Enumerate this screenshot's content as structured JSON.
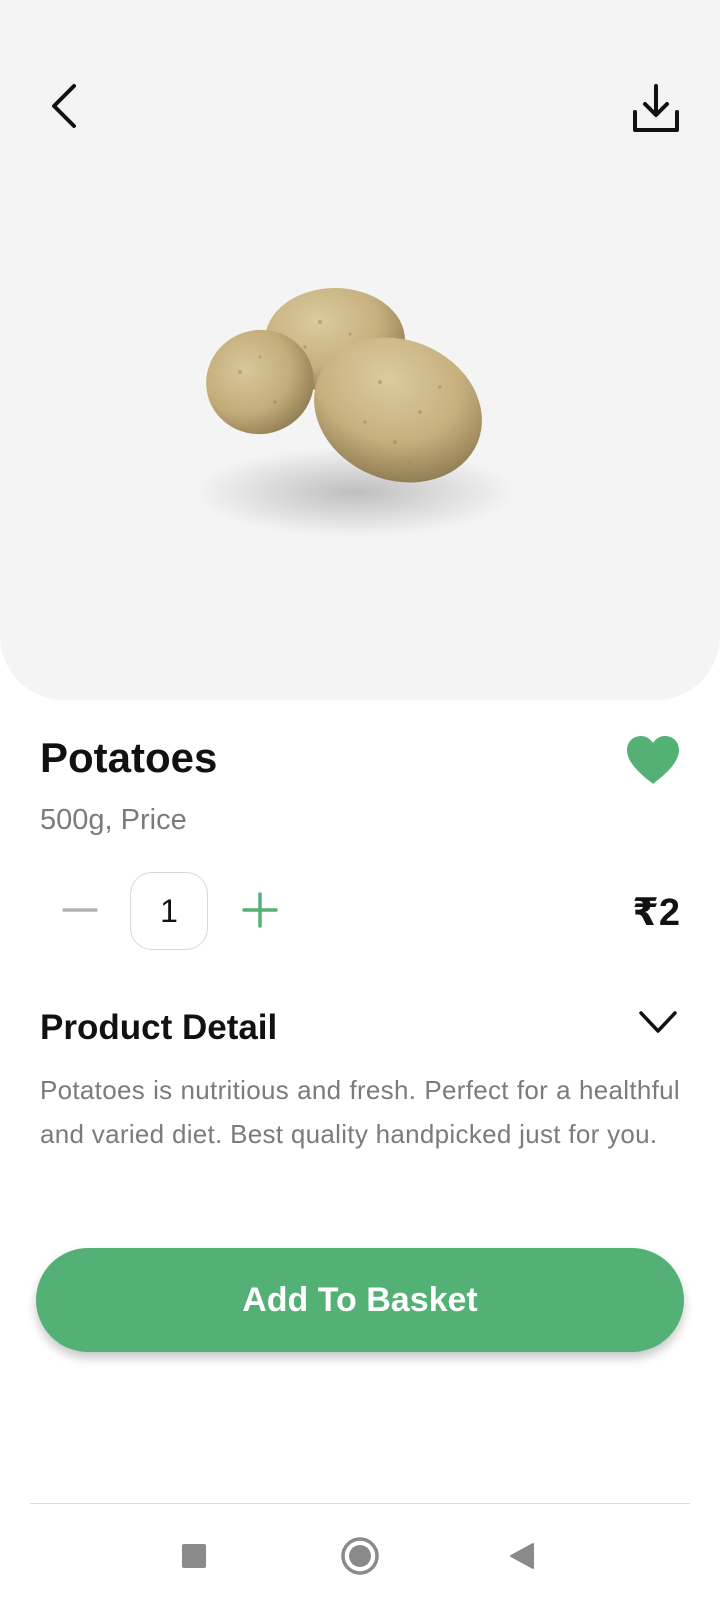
{
  "product": {
    "name": "Potatoes",
    "subtitle": "500g, Price",
    "quantity": "1",
    "price": "₹2",
    "favorited": true
  },
  "detail": {
    "title": "Product Detail",
    "description": "Potatoes is nutritious and fresh. Perfect for a healthful and varied diet. Best quality handpicked just for you."
  },
  "actions": {
    "add_to_basket_label": "Add To Basket"
  },
  "icons": {
    "back": "back-chevron-icon",
    "download": "download-icon",
    "favorite": "heart-icon",
    "decrement": "minus-icon",
    "increment": "plus-icon",
    "expand": "chevron-down-icon",
    "nav_recent": "square-icon",
    "nav_home": "circle-icon",
    "nav_back": "triangle-icon"
  },
  "colors": {
    "accent": "#53b175",
    "hero_background": "#f4f4f5",
    "text_primary": "#111111",
    "text_secondary": "#7b7b7b"
  }
}
